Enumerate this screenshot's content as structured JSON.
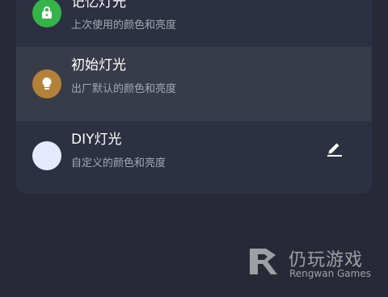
{
  "light_modes": [
    {
      "title": "记忆灯光",
      "desc": "上次使用的颜色和亮度",
      "icon": "memory-lock-icon",
      "icon_color": "#36b34a",
      "selected": false
    },
    {
      "title": "初始灯光",
      "desc": "出厂默认的颜色和亮度",
      "icon": "lightbulb-icon",
      "icon_color": "#b3813a",
      "selected": true
    },
    {
      "title": "DIY灯光",
      "desc": "自定义的颜色和亮度",
      "icon": "color-swatch-icon",
      "icon_color": "#e6e8ff",
      "selected": false,
      "action_icon": "edit-pencil-icon"
    }
  ],
  "watermark": {
    "cn": "仍玩游戏",
    "en": "Rengwan Games"
  }
}
